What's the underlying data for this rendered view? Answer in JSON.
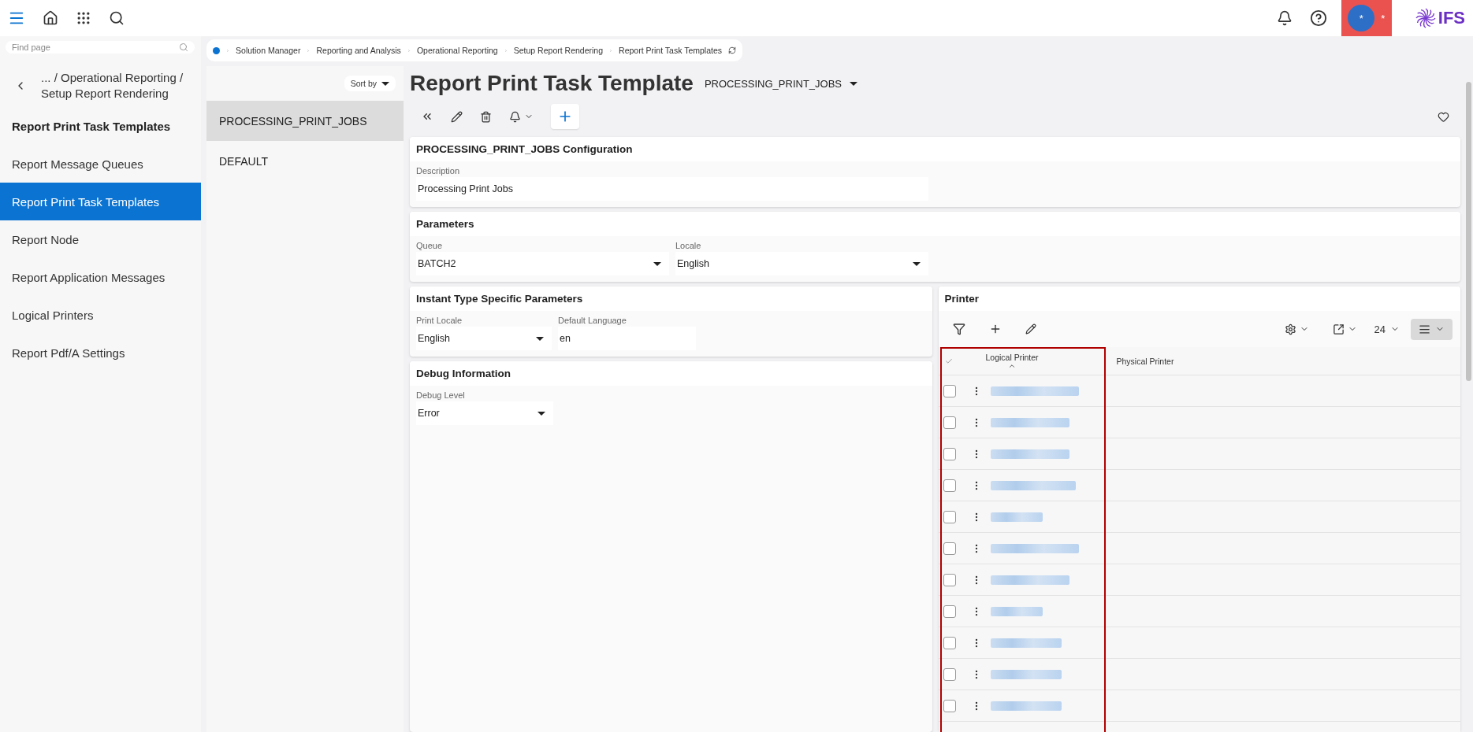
{
  "top_bar": {
    "avatar_text": "*",
    "avatar_badge": "*",
    "logo": "IFS"
  },
  "sidebar": {
    "search": {
      "placeholder": "Find page"
    },
    "back_path": "... / Operational Reporting / Setup Report Rendering",
    "heading": "Report Print Task Templates",
    "items": [
      {
        "label": "Report Message Queues",
        "selected": false
      },
      {
        "label": "Report Print Task Templates",
        "selected": true
      },
      {
        "label": "Report Node",
        "selected": false
      },
      {
        "label": "Report Application Messages",
        "selected": false
      },
      {
        "label": "Logical Printers",
        "selected": false
      },
      {
        "label": "Report Pdf/A Settings",
        "selected": false
      }
    ]
  },
  "breadcrumb": [
    "Solution Manager",
    "Reporting and Analysis",
    "Operational Reporting",
    "Setup Report Rendering",
    "Report Print Task Templates"
  ],
  "records": {
    "sort_label": "Sort by",
    "items": [
      {
        "label": "PROCESSING_PRINT_JOBS",
        "selected": true
      },
      {
        "label": "DEFAULT",
        "selected": false
      }
    ]
  },
  "page": {
    "title": "Report Print Task Template",
    "record": "PROCESSING_PRINT_JOBS"
  },
  "configuration": {
    "title": "PROCESSING_PRINT_JOBS Configuration",
    "fields": [
      {
        "label": "Description",
        "value": "Processing Print Jobs",
        "kind": "text"
      }
    ]
  },
  "parameters": {
    "title": "Parameters",
    "fields": [
      {
        "label": "Queue",
        "value": "BATCH2",
        "kind": "select"
      },
      {
        "label": "Locale",
        "value": "English",
        "kind": "select"
      }
    ]
  },
  "instant": {
    "title": "Instant Type Specific Parameters",
    "fields": [
      {
        "label": "Print Locale",
        "value": "English",
        "kind": "select"
      },
      {
        "label": "Default Language",
        "value": "en",
        "kind": "text"
      }
    ]
  },
  "debug": {
    "title": "Debug Information",
    "fields": [
      {
        "label": "Debug Level",
        "value": "Error",
        "kind": "select"
      }
    ]
  },
  "printer": {
    "title": "Printer",
    "page_size": "24",
    "columns": [
      {
        "label": "Logical Printer",
        "sorted": true
      },
      {
        "label": "Physical Printer",
        "sorted": false
      }
    ],
    "rows": [
      {
        "checked": false
      },
      {
        "checked": false
      },
      {
        "checked": false
      },
      {
        "checked": false
      },
      {
        "checked": false
      },
      {
        "checked": false
      },
      {
        "checked": false
      },
      {
        "checked": false
      },
      {
        "checked": false
      },
      {
        "checked": false
      },
      {
        "checked": false
      }
    ]
  }
}
